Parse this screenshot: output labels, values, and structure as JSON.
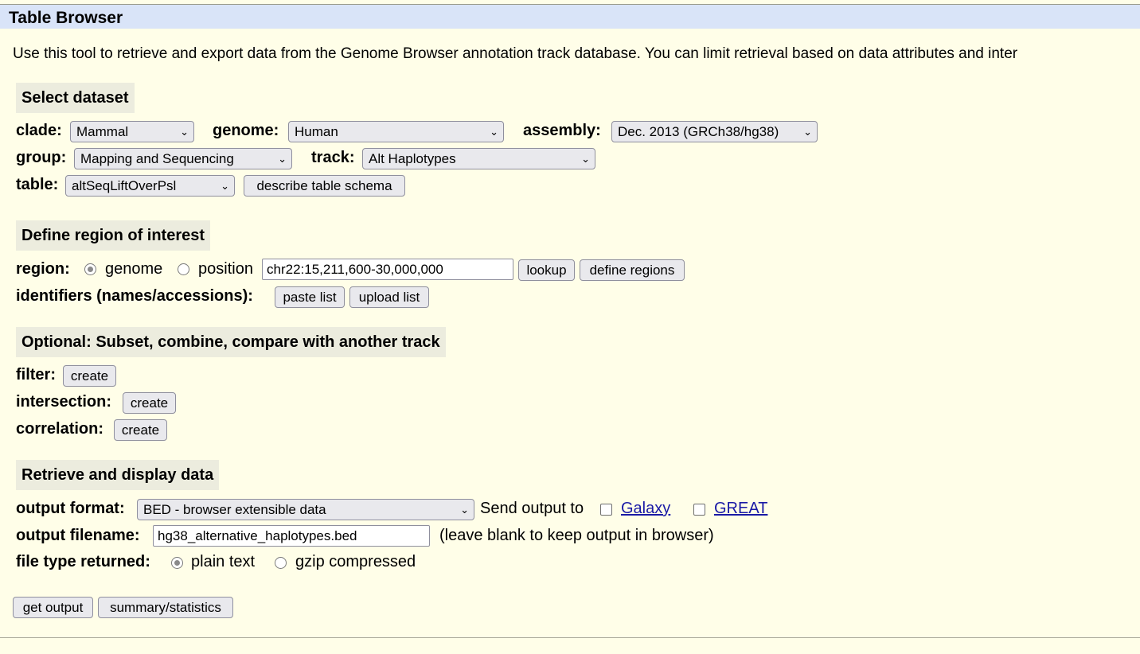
{
  "title": "Table Browser",
  "intro": "Use this tool to retrieve and export data from the Genome Browser annotation track database. You can limit retrieval based on data attributes and inter",
  "select_dataset": {
    "heading": "Select dataset",
    "clade_label": "clade:",
    "clade_value": "Mammal",
    "genome_label": "genome:",
    "genome_value": "Human",
    "assembly_label": "assembly:",
    "assembly_value": "Dec. 2013 (GRCh38/hg38)",
    "group_label": "group:",
    "group_value": "Mapping and Sequencing",
    "track_label": "track:",
    "track_value": "Alt Haplotypes",
    "table_label": "table:",
    "table_value": "altSeqLiftOverPsl",
    "describe_button": "describe table schema"
  },
  "region_section": {
    "heading": "Define region of interest",
    "region_label": "region:",
    "genome_option": "genome",
    "position_option": "position",
    "selected": "genome",
    "position_value": "chr22:15,211,600-30,000,000",
    "lookup_button": "lookup",
    "define_regions_button": "define regions",
    "identifiers_label": "identifiers (names/accessions):",
    "paste_list_button": "paste list",
    "upload_list_button": "upload list"
  },
  "optional_section": {
    "heading": "Optional: Subset, combine, compare with another track",
    "filter_label": "filter:",
    "intersection_label": "intersection:",
    "correlation_label": "correlation:",
    "create_button": "create"
  },
  "retrieve_section": {
    "heading": "Retrieve and display data",
    "output_format_label": "output format:",
    "output_format_value": "BED - browser extensible data",
    "send_output_label": "Send output to",
    "galaxy_link": "Galaxy",
    "great_link": "GREAT",
    "output_filename_label": "output filename:",
    "output_filename_value": "hg38_alternative_haplotypes.bed",
    "filename_hint": "(leave blank to keep output in browser)",
    "file_type_label": "file type returned:",
    "plain_text_option": "plain text",
    "gzip_option": "gzip compressed",
    "file_type_selected": "plain text"
  },
  "actions": {
    "get_output_button": "get output",
    "summary_button": "summary/statistics"
  },
  "icons": {
    "dropdown": "chevron-down-icon"
  },
  "colors": {
    "page_background": "#fffee8",
    "title_bar": "#d9e4f8",
    "section_heading": "#ececde",
    "link": "#1a1aa6"
  }
}
